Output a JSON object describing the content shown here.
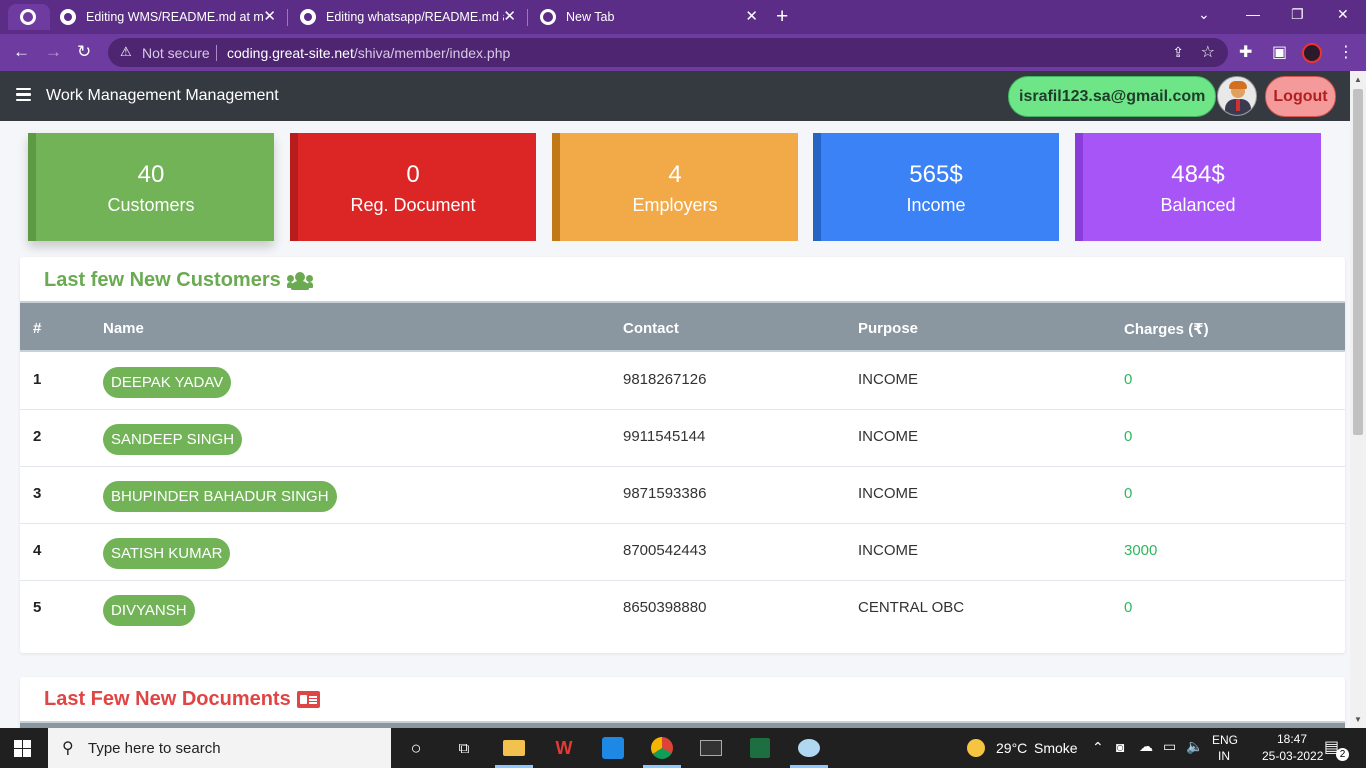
{
  "browser": {
    "tabs": [
      {
        "title": "Editing WMS/README.md at main",
        "icon": "github-icon"
      },
      {
        "title": "Editing whatsapp/README.md at main",
        "icon": "github-icon"
      },
      {
        "title": "New Tab",
        "icon": "chrome-icon"
      }
    ],
    "security_label": "Not secure",
    "url_host": "coding.great-site.net",
    "url_path": "/shiva/member/index.php"
  },
  "navbar": {
    "brand": "Work Management Management",
    "email": "israfil123.sa@gmail.com",
    "logout_label": "Logout"
  },
  "stats": [
    {
      "value": "40",
      "label": "Customers",
      "color": "#71b356"
    },
    {
      "value": "0",
      "label": "Reg. Document",
      "color": "#dc2626"
    },
    {
      "value": "4",
      "label": "Employers",
      "color": "#f2a947"
    },
    {
      "value": "565$",
      "label": "Income",
      "color": "#3b82f6"
    },
    {
      "value": "484$",
      "label": "Balanced",
      "color": "#a855f7"
    }
  ],
  "customers": {
    "title": "Last few New Customers",
    "columns": [
      "#",
      "Name",
      "Contact",
      "Purpose",
      "Charges (₹)"
    ],
    "rows": [
      {
        "idx": "1",
        "name": "DEEPAK YADAV",
        "contact": "9818267126",
        "purpose": "INCOME",
        "charges": "0"
      },
      {
        "idx": "2",
        "name": "SANDEEP SINGH",
        "contact": "9911545144",
        "purpose": "INCOME",
        "charges": "0"
      },
      {
        "idx": "3",
        "name": "BHUPINDER BAHADUR SINGH",
        "contact": "9871593386",
        "purpose": "INCOME",
        "charges": "0"
      },
      {
        "idx": "4",
        "name": "SATISH KUMAR",
        "contact": "8700542443",
        "purpose": "INCOME",
        "charges": "3000"
      },
      {
        "idx": "5",
        "name": "DIVYANSH",
        "contact": "8650398880",
        "purpose": "CENTRAL OBC",
        "charges": "0"
      }
    ]
  },
  "documents": {
    "title": "Last Few New Documents"
  },
  "taskbar": {
    "search_placeholder": "Type here to search",
    "weather_temp": "29°C",
    "weather_desc": "Smoke",
    "lang_top": "ENG",
    "lang_bottom": "IN",
    "time": "18:47",
    "date": "25-03-2022",
    "notifications": "2"
  }
}
